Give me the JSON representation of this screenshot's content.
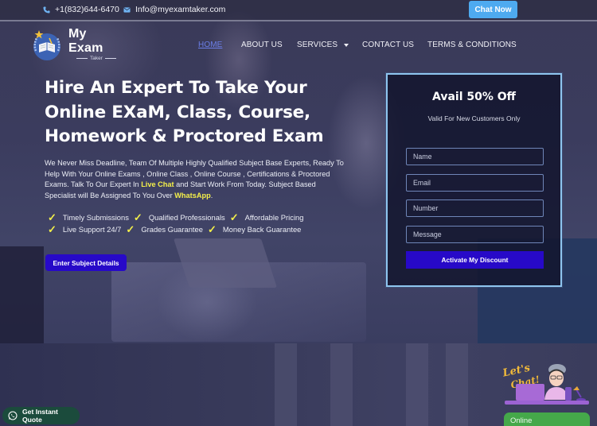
{
  "topbar": {
    "phone": "+1(832)644-6470",
    "email": "Info@myexamtaker.com",
    "phone_icon": "phone-icon",
    "email_icon": "mail-icon",
    "chat_button": "Chat Now"
  },
  "logo": {
    "title": "My Exam",
    "subtitle": "Taker",
    "emblem_icon": "book-laurel-icon"
  },
  "nav": {
    "items": [
      {
        "label": "HOME",
        "active": true
      },
      {
        "label": "ABOUT US",
        "active": false
      },
      {
        "label": "SERVICES",
        "active": false,
        "has_dropdown": true
      },
      {
        "label": "CONTACT US",
        "active": false
      },
      {
        "label": "TERMS & CONDITIONS",
        "active": false
      }
    ]
  },
  "hero": {
    "title": "Hire An Expert To Take Your Online EXaM, Class, Course, Homework & Proctored Exam",
    "desc_part1": "We Never Miss Deadline, Team Of Multiple Highly Qualified Subject Base Experts, Ready To Help With Your Online Exams , Online Class , Online Course , Certifications & Proctored Exams. Talk To Our Expert In ",
    "desc_highlight1": "Live Chat",
    "desc_part2": " and Start Work From Today. Subject Based Specialist will Be Assigned To You Over ",
    "desc_highlight2": "WhatsApp",
    "desc_part3": ".",
    "features": [
      [
        "Timely Submissions",
        "Qualified Professionals",
        "Affordable Pricing"
      ],
      [
        "Live Support 24/7",
        "Grades Guarantee",
        "Money Back Guarantee"
      ]
    ],
    "check_symbol": "✓",
    "cta": "Enter Subject Details"
  },
  "form": {
    "title": "Avail 50% Off",
    "subtitle": "Valid For New Customers Only",
    "fields": {
      "name": {
        "placeholder": "Name",
        "value": ""
      },
      "email": {
        "placeholder": "Email",
        "value": ""
      },
      "number": {
        "placeholder": "Number",
        "value": ""
      },
      "message": {
        "placeholder": "Message",
        "value": ""
      }
    },
    "submit": "Activate My Discount"
  },
  "widgets": {
    "quote_button": "Get Instant Quote",
    "quote_icon": "whatsapp-icon",
    "chat_art_text": "Let's Chat!",
    "chat_status": "Online"
  },
  "colors": {
    "accent_blue": "#2709c8",
    "chat_now_blue": "#4eaaf0",
    "highlight_yellow": "#f5f04a",
    "nav_active": "#6b7ee8",
    "form_border": "#8ec5ef",
    "online_green": "#45a84a",
    "whatsapp_green": "#1b4b3c"
  }
}
